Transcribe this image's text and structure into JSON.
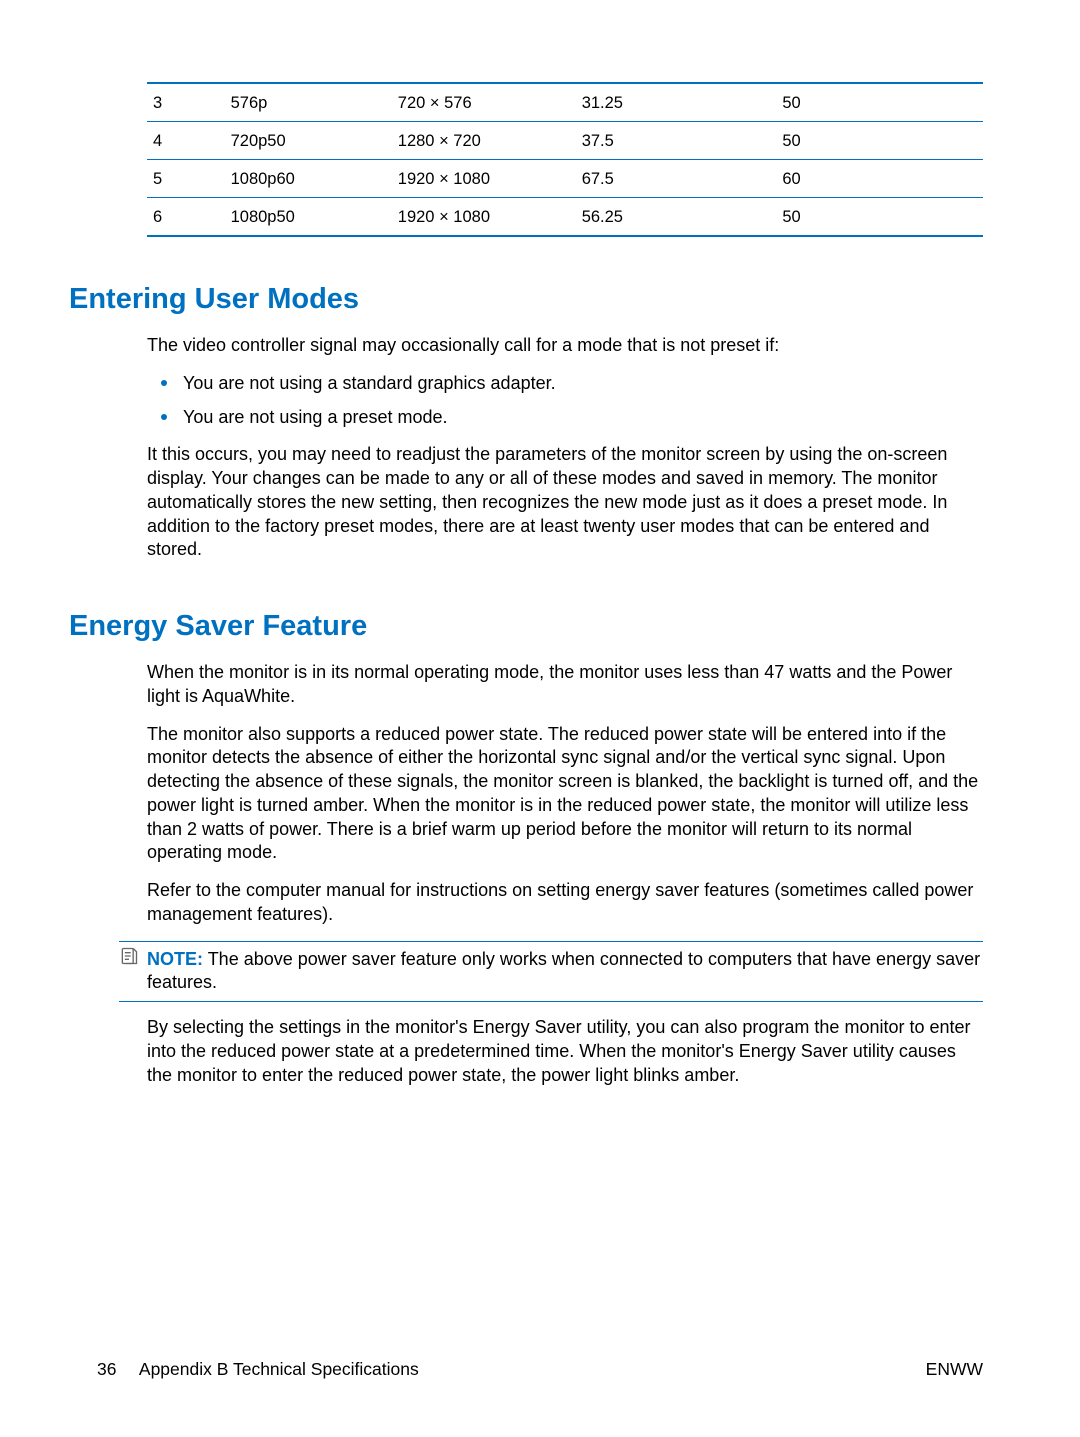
{
  "table": {
    "rows": [
      {
        "n": "3",
        "name": "576p",
        "res": "720 × 576",
        "h": "31.25",
        "v": "50"
      },
      {
        "n": "4",
        "name": "720p50",
        "res": "1280 × 720",
        "h": "37.5",
        "v": "50"
      },
      {
        "n": "5",
        "name": "1080p60",
        "res": "1920 × 1080",
        "h": "67.5",
        "v": "60"
      },
      {
        "n": "6",
        "name": "1080p50",
        "res": "1920 × 1080",
        "h": "56.25",
        "v": "50"
      }
    ]
  },
  "section1": {
    "heading": "Entering User Modes",
    "p1": "The video controller signal may occasionally call for a mode that is not preset if:",
    "bullets": [
      "You are not using a standard graphics adapter.",
      "You are not using a preset mode."
    ],
    "p2": "It this occurs, you may need to readjust the parameters of the monitor screen by using the on-screen display. Your changes can be made to any or all of these modes and saved in memory. The monitor automatically stores the new setting, then recognizes the new mode just as it does a preset mode. In addition to the factory preset modes, there are at least twenty user modes that can be entered and stored."
  },
  "section2": {
    "heading": "Energy Saver Feature",
    "p1": "When the monitor is in its normal operating mode, the monitor uses less than 47 watts and the Power light is AquaWhite.",
    "p2": "The monitor also supports a reduced power state. The reduced power state will be entered into if the monitor detects the absence of either the horizontal sync signal and/or the vertical sync signal. Upon detecting the absence of these signals, the monitor screen is blanked, the backlight is turned off, and the power light is turned amber. When the monitor is in the reduced power state, the monitor will utilize less than 2 watts of power. There is a brief warm up period before the monitor will return to its normal operating mode.",
    "p3": "Refer to the computer manual for instructions on setting energy saver features (sometimes called power management features).",
    "note_label": "NOTE:",
    "note_text": "The above power saver feature only works when connected to computers that have energy saver features.",
    "p4": "By selecting the settings in the monitor's Energy Saver utility, you can also program the monitor to enter into the reduced power state at a predetermined time. When the monitor's Energy Saver utility causes the monitor to enter the reduced power state, the power light blinks amber."
  },
  "footer": {
    "page": "36",
    "left": "Appendix B   Technical Specifications",
    "right": "ENWW"
  }
}
